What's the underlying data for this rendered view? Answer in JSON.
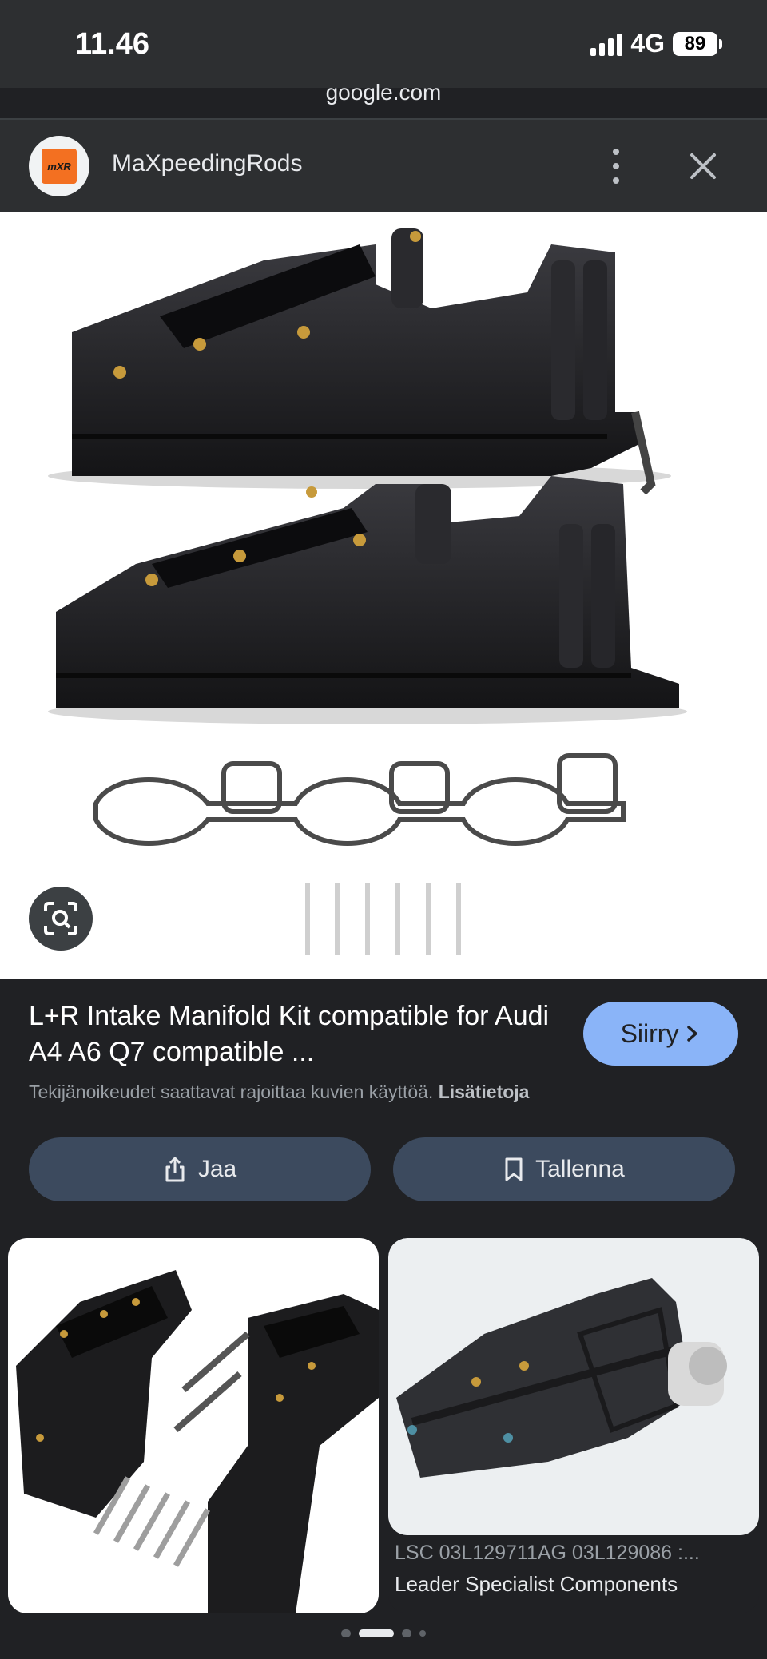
{
  "status_bar": {
    "time": "11.46",
    "network": "4G",
    "battery": "89"
  },
  "browser": {
    "domain": "google.com"
  },
  "source": {
    "name": "MaXpeedingRods",
    "logo_text": "mXR"
  },
  "result": {
    "title": "L+R Intake Manifold Kit compatible for Audi A4 A6 Q7 compatible ...",
    "visit_label": "Siirry",
    "copyright_text": "Tekijänoikeudet saattavat rajoittaa kuvien käyttöä.",
    "learn_more": "Lisätietoja"
  },
  "actions": {
    "share_label": "Jaa",
    "save_label": "Tallenna"
  },
  "related": [
    {
      "title": "",
      "source": ""
    },
    {
      "title": "LSC 03L129711AG 03L129086 :...",
      "source": "Leader Specialist Components"
    }
  ],
  "carousel": {
    "total": 4,
    "active": 1
  },
  "colors": {
    "accent_button": "#8ab4f8",
    "action_button": "#3c4a5e",
    "background": "#202124",
    "logo_orange": "#f37021"
  }
}
